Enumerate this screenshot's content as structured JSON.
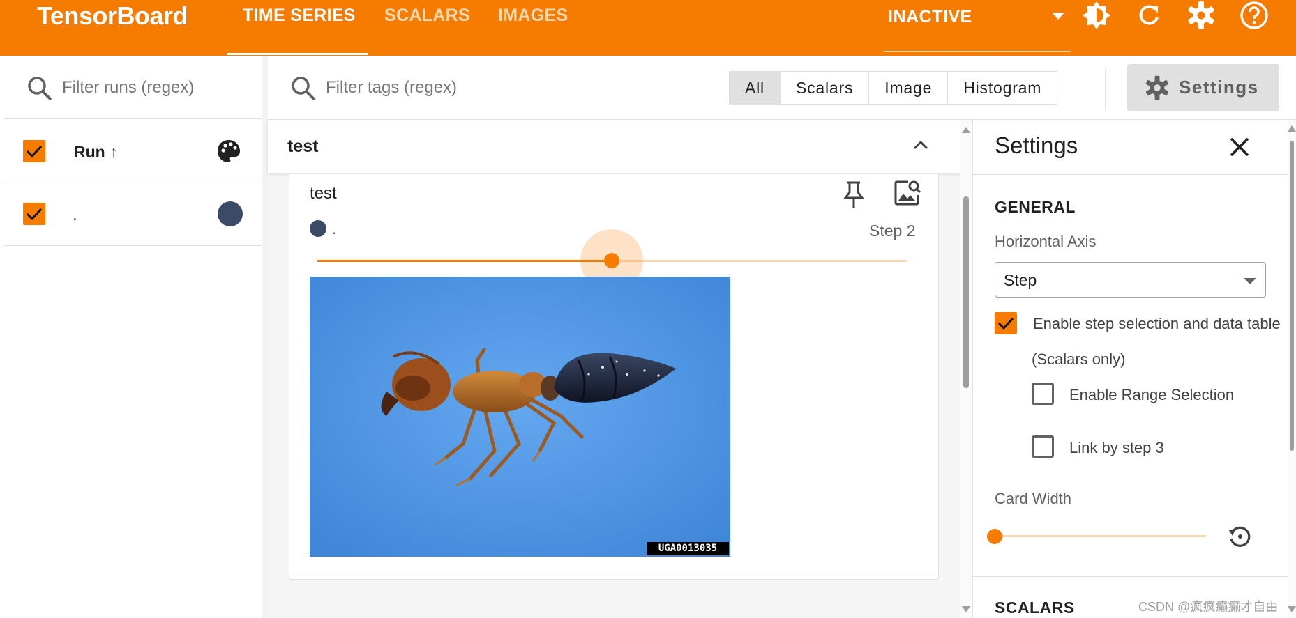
{
  "colors": {
    "accent": "#f57c00",
    "run_color": "#3c4b65"
  },
  "header": {
    "brand": "TensorBoard",
    "tabs": [
      {
        "label": "TIME SERIES",
        "active": true
      },
      {
        "label": "SCALARS",
        "active": false
      },
      {
        "label": "IMAGES",
        "active": false
      }
    ],
    "plugin_select": "INACTIVE",
    "icons": [
      "theme-toggle-icon",
      "refresh-icon",
      "settings-gear-icon",
      "help-icon"
    ]
  },
  "runs_panel": {
    "filter_placeholder": "Filter runs (regex)",
    "column_header": "Run",
    "sort_indicator": "↑",
    "runs": [
      {
        "name": ".",
        "checked": true
      }
    ]
  },
  "tag_bar": {
    "filter_placeholder": "Filter tags (regex)",
    "type_filters": [
      {
        "label": "All",
        "active": true
      },
      {
        "label": "Scalars",
        "active": false
      },
      {
        "label": "Image",
        "active": false
      },
      {
        "label": "Histogram",
        "active": false
      }
    ],
    "settings_button": "Settings"
  },
  "main": {
    "group_title": "test",
    "card": {
      "title": "test",
      "legend_run": ".",
      "step_label": "Step 2",
      "step_slider_fraction": 0.5,
      "image_watermark": "UGA0013035"
    }
  },
  "settings_panel": {
    "title": "Settings",
    "general_heading": "GENERAL",
    "horizontal_axis_label": "Horizontal Axis",
    "horizontal_axis_value": "Step",
    "step_selection_label": "Enable step selection and data table",
    "step_selection_note": "(Scalars only)",
    "step_selection_checked": true,
    "range_selection_label": "Enable Range Selection",
    "range_selection_checked": false,
    "link_by_step_label": "Link by step 3",
    "link_by_step_checked": false,
    "card_width_label": "Card Width",
    "card_width_fraction": 0,
    "scalars_heading": "SCALARS"
  },
  "watermark": "CSDN @疯疯癫癫才自由"
}
